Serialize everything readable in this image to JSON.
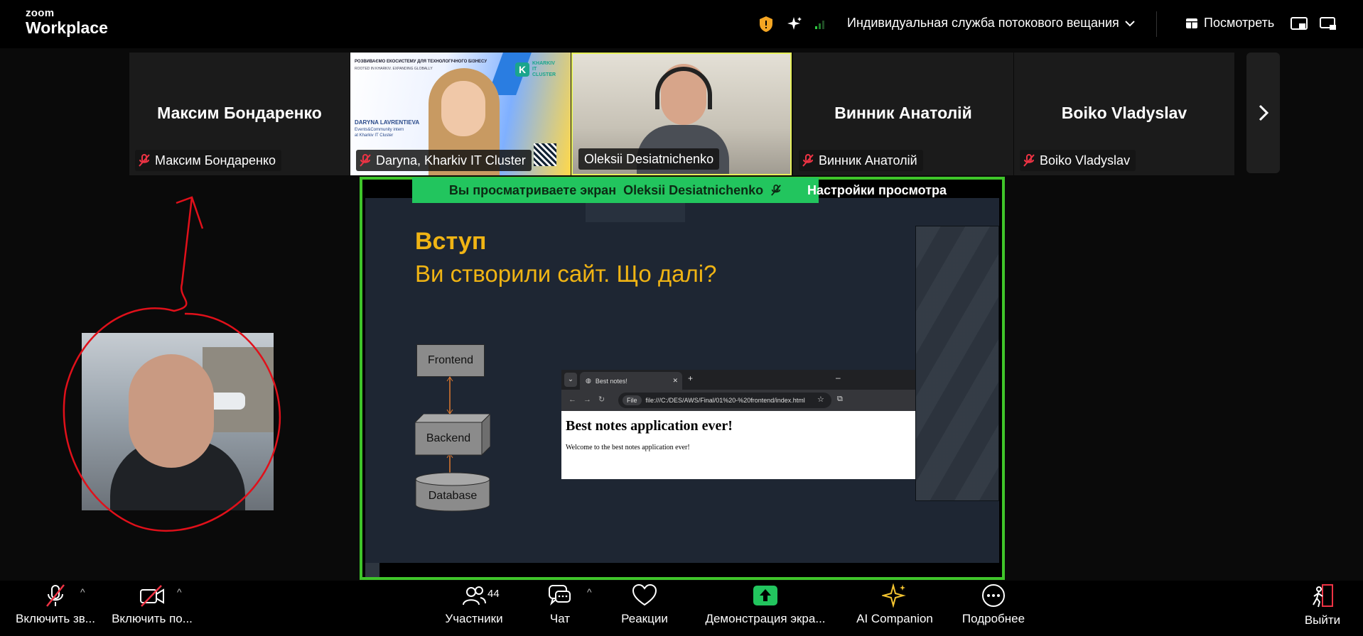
{
  "app": {
    "brand_small": "zoom",
    "brand_big": "Workplace"
  },
  "topbar": {
    "stream_label": "Индивидуальная служба потокового вещания",
    "view_label": "Посмотреть"
  },
  "participants_strip": [
    {
      "title": "Максим Бондаренко",
      "label": "Максим Бондаренко",
      "muted": true
    },
    {
      "title": "",
      "label": "Daryna, Kharkiv IT Cluster",
      "muted": true
    },
    {
      "title": "",
      "label": "Oleksii Desiatnichenko",
      "muted": false
    },
    {
      "title": "Винник Анатолій",
      "label": "Винник Анатолій",
      "muted": true
    },
    {
      "title": "Boiko Vladyslav",
      "label": "Boiko Vladyslav",
      "muted": true
    }
  ],
  "daryna_slide": {
    "header": "РОЗВИВАЄМО ЕКОСИСТЕМУ ДЛЯ ТЕХНОЛОГІЧНОГО БІЗНЕСУ",
    "subheader": "ROOTED IN KHARKIV. EXPANDING GLOBALLY",
    "brand": "KHARKIV IT CLUSTER",
    "name": "DARYNA LAVRENTIEVA",
    "role1": "Events&Community intern",
    "role2": "at Kharkiv IT Cluster"
  },
  "share": {
    "banner_prefix": "Вы просматриваете экран",
    "banner_name": "Oleksii Desiatnichenko",
    "settings_label": "Настройки просмотра"
  },
  "slide": {
    "heading": "Вступ",
    "subheading": "Ви створили сайт. Що далі?",
    "diagram": {
      "frontend": "Frontend",
      "backend": "Backend",
      "database": "Database"
    },
    "browser": {
      "tab_title": "Best notes!",
      "file_chip": "File",
      "url": "file:///C:/DES/AWS/Final/01%20-%20frontend/index.html",
      "page_heading": "Best notes application ever!",
      "page_text": "Welcome to the best notes application ever!"
    }
  },
  "bottombar": {
    "mic_label": "Включить зв...",
    "video_label": "Включить по...",
    "participants_label": "Участники",
    "participants_count": "44",
    "chat_label": "Чат",
    "reactions_label": "Реакции",
    "share_label": "Демонстрация экра...",
    "ai_label": "AI Companion",
    "more_label": "Подробнее",
    "leave_label": "Выйти"
  },
  "colors": {
    "accent_green": "#22c55e",
    "share_border": "#3fc52a",
    "slide_yellow": "#f0b414",
    "annotation_red": "#e0101a"
  }
}
